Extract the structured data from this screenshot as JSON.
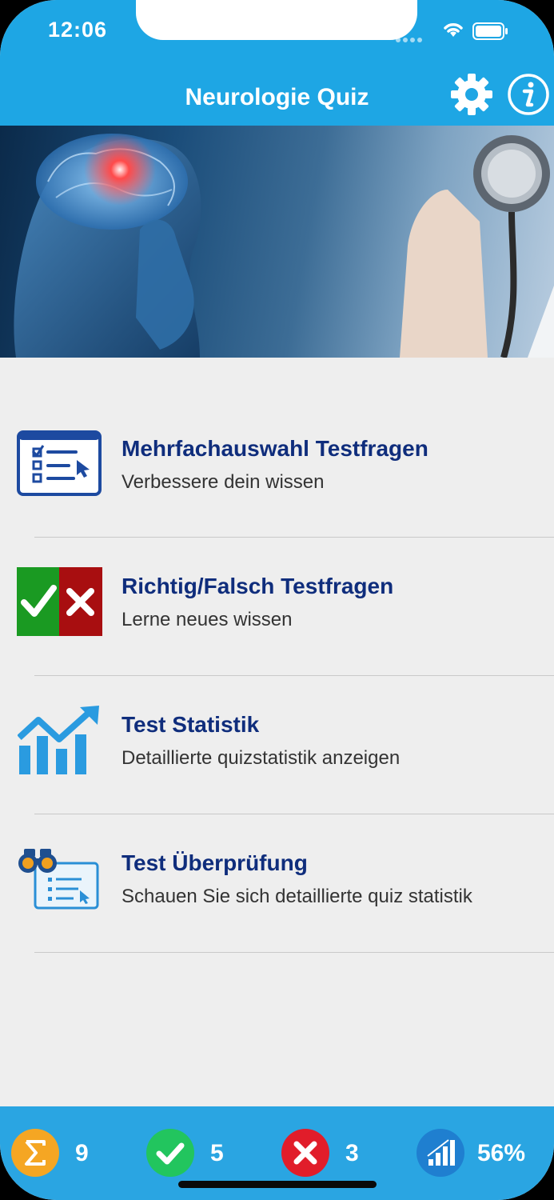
{
  "status": {
    "time": "12:06"
  },
  "nav": {
    "title": "Neurologie Quiz"
  },
  "menu": [
    {
      "title": "Mehrfachauswahl Testfragen",
      "subtitle": "Verbessere dein wissen",
      "icon": "checklist-icon"
    },
    {
      "title": "Richtig/Falsch Testfragen",
      "subtitle": "Lerne neues wissen",
      "icon": "true-false-icon"
    },
    {
      "title": "Test Statistik",
      "subtitle": "Detaillierte quizstatistik anzeigen",
      "icon": "chart-growth-icon"
    },
    {
      "title": "Test Überprüfung",
      "subtitle": "Schauen Sie sich detaillierte quiz statistik",
      "icon": "binoculars-review-icon"
    }
  ],
  "stats": {
    "total": "9",
    "correct": "5",
    "wrong": "3",
    "percent": "56%"
  },
  "colors": {
    "accent": "#1ea6e4",
    "bottom_bar": "#2aa5e2",
    "title_text": "#0f2d7c",
    "sum_orange": "#f5a623",
    "correct_green": "#22c55e",
    "wrong_red": "#e11d2a",
    "chart_blue": "#1f7fd0"
  }
}
